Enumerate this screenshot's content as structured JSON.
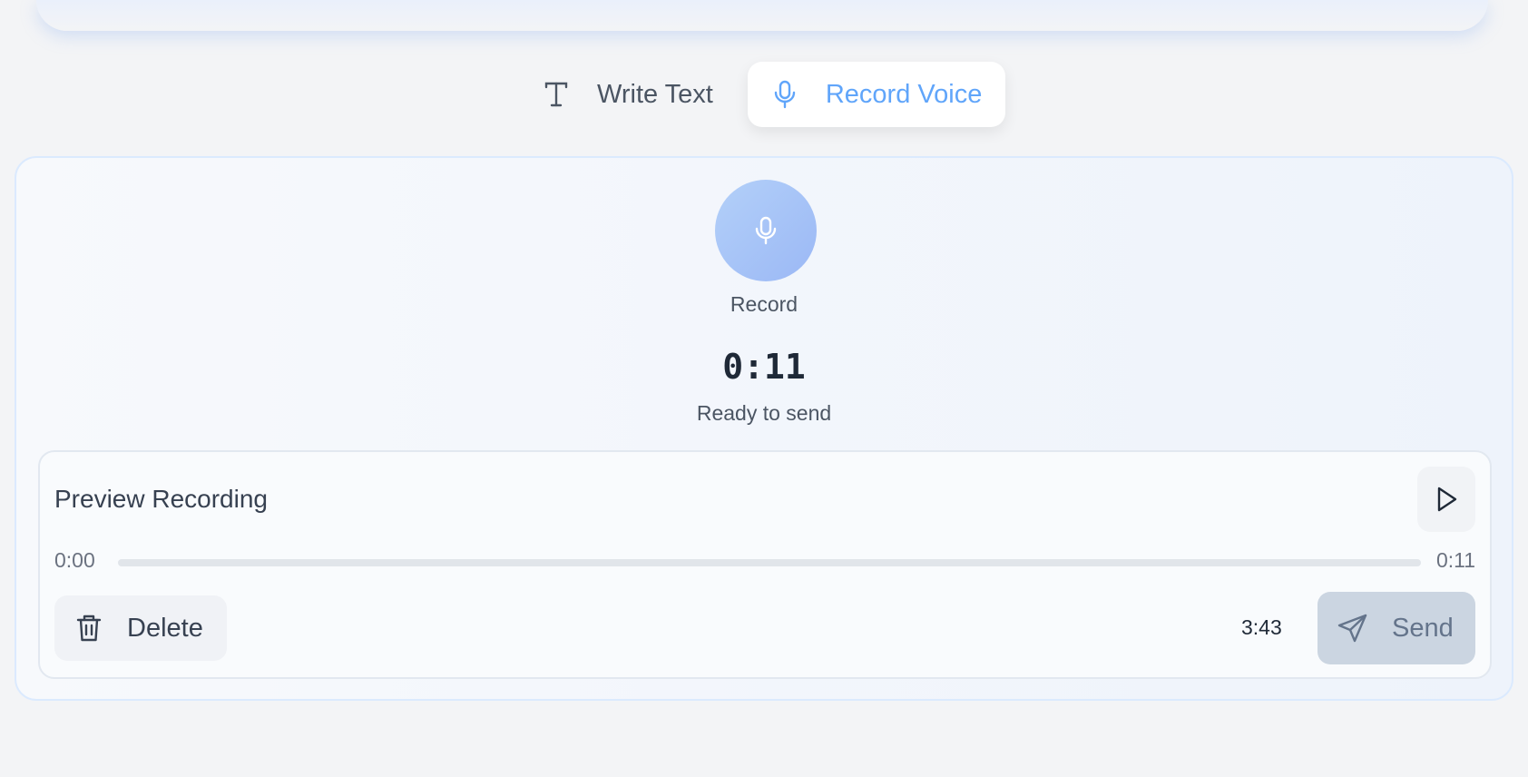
{
  "mode_tabs": [
    {
      "label": "Write Text",
      "icon": "text-icon",
      "active": false
    },
    {
      "label": "Record Voice",
      "icon": "microphone-icon",
      "active": true
    }
  ],
  "recorder": {
    "record_label": "Record",
    "timer": "0:11",
    "status": "Ready to send"
  },
  "preview": {
    "title": "Preview Recording",
    "time_current": "0:00",
    "time_total": "0:11",
    "progress": 0,
    "delete_label": "Delete",
    "remaining_time": "3:43",
    "send_label": "Send"
  },
  "colors": {
    "accent": "#60a5fa",
    "send_disabled_bg": "#cbd5e1",
    "card_border": "#dbeafe"
  }
}
